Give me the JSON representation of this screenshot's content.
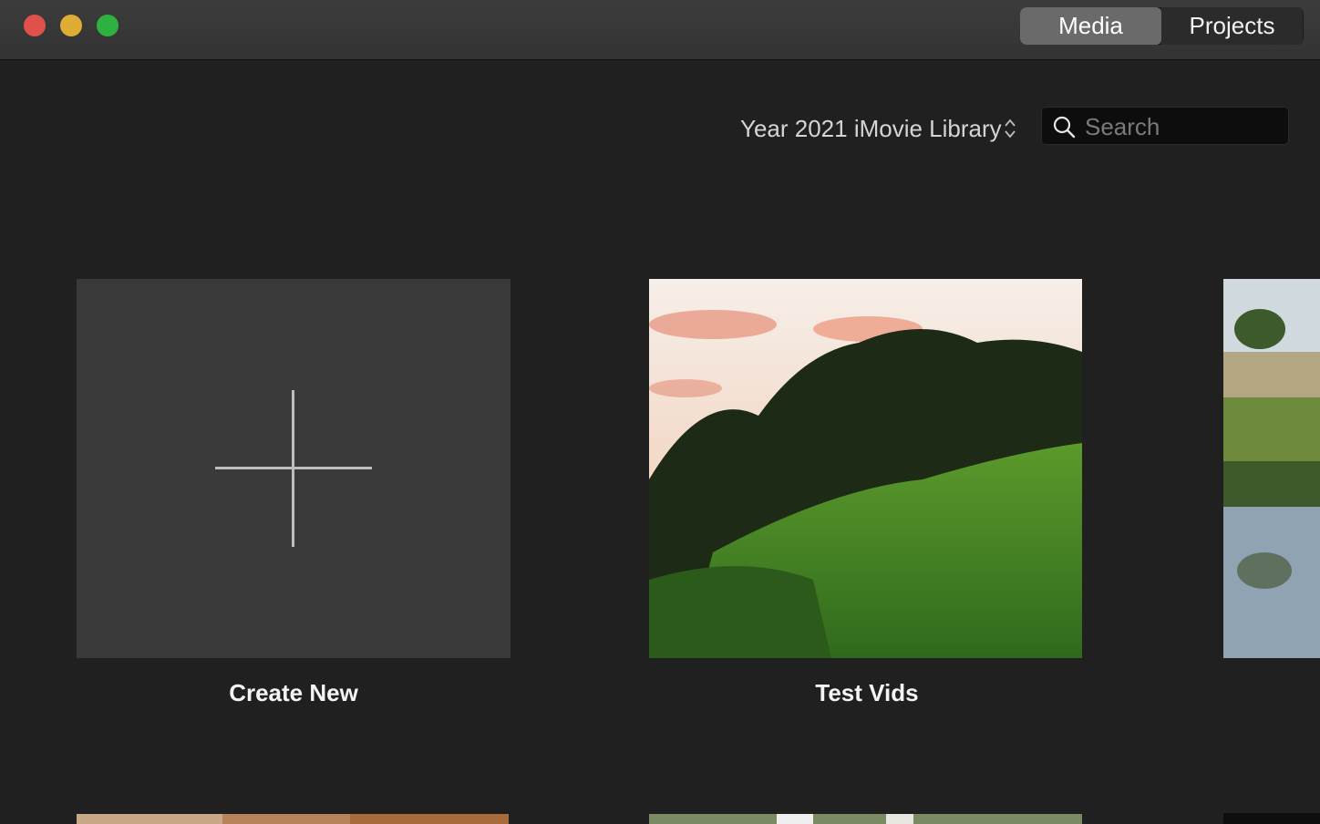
{
  "window": {
    "controls": [
      "close",
      "minimize",
      "zoom"
    ],
    "segmented": {
      "media_label": "Media",
      "projects_label": "Projects",
      "selected": "Media"
    }
  },
  "toolbar": {
    "library_label": "Year 2021 iMovie Library",
    "search": {
      "placeholder": "Search",
      "value": ""
    }
  },
  "projects": [
    {
      "label": "Create New",
      "type": "create-new",
      "icon": "plus-icon"
    },
    {
      "label": "Test Vids",
      "type": "project"
    },
    {
      "label": "",
      "type": "project"
    }
  ],
  "colors": {
    "background": "#202020",
    "card": "#3a3a3a",
    "close": "#e0514b",
    "minimize": "#dfad34",
    "zoom": "#2fb140"
  }
}
